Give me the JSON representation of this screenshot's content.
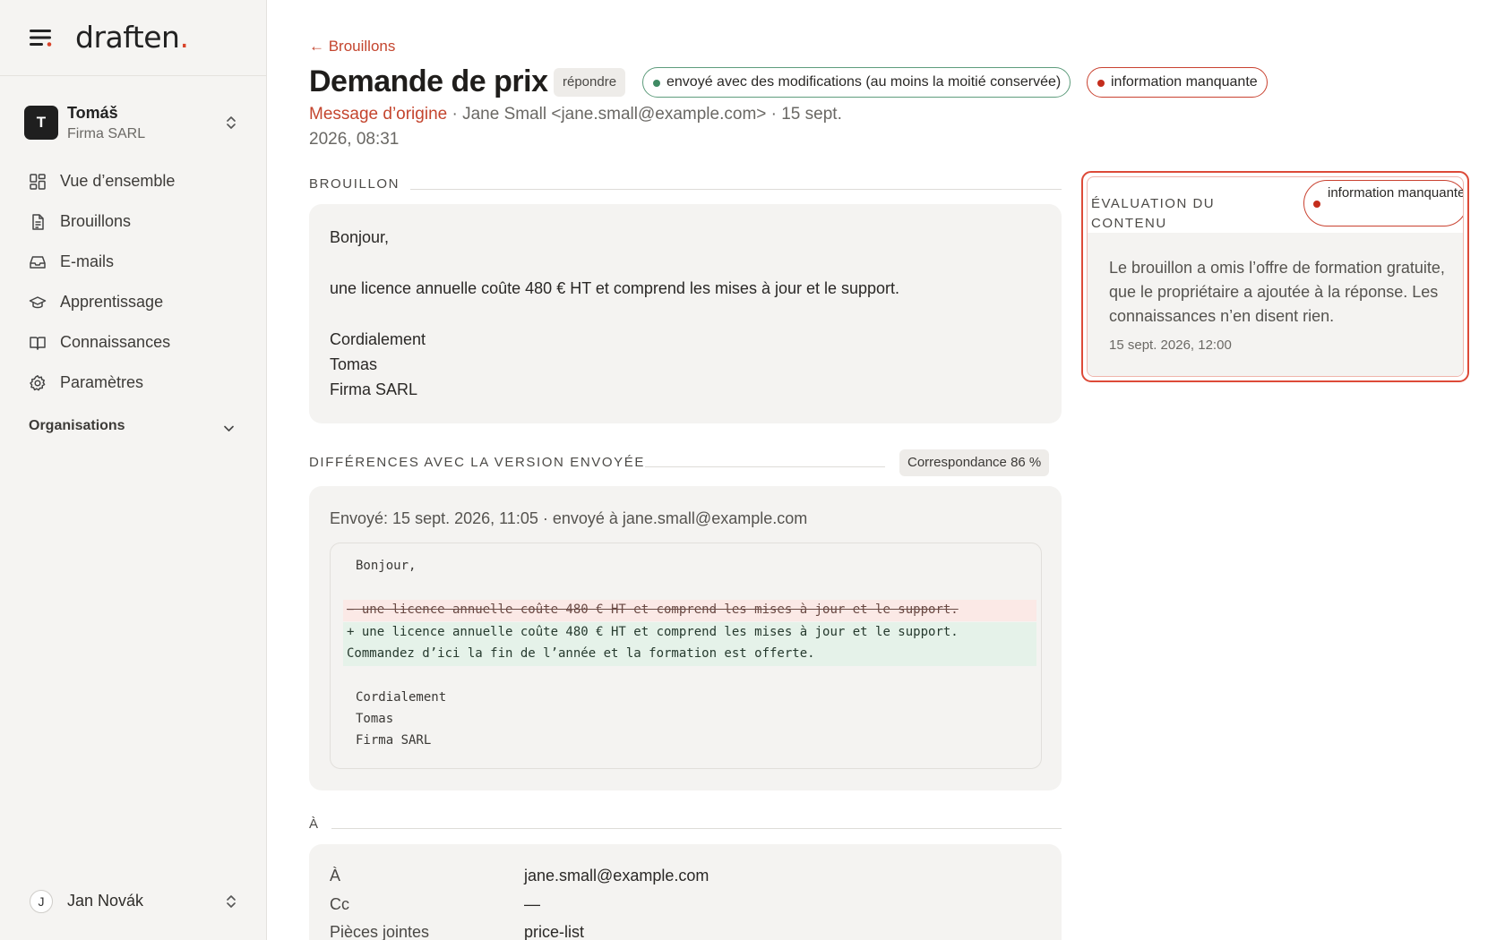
{
  "brand": {
    "name": "draften",
    "dot": "."
  },
  "org": {
    "initial": "T",
    "name": "Tomáš",
    "company": "Firma SARL"
  },
  "nav": [
    {
      "label": "Vue d’ensemble",
      "icon": "dashboard-icon"
    },
    {
      "label": "Brouillons",
      "icon": "document-icon"
    },
    {
      "label": "E-mails",
      "icon": "inbox-icon"
    },
    {
      "label": "Apprentissage",
      "icon": "graduation-cap-icon"
    },
    {
      "label": "Connaissances",
      "icon": "book-icon"
    },
    {
      "label": "Paramètres",
      "icon": "gear-icon"
    }
  ],
  "organisations_label": "Organisations",
  "user": {
    "initial": "J",
    "name": "Jan Novák"
  },
  "main": {
    "back_label": "← Brouillons",
    "title": "Demande de prix",
    "type_tag": "répondre",
    "status_pill": "envoyé avec des modifications (au moins la moitié conservée)",
    "issue_pill": "information manquante",
    "origin": {
      "link": "Message d’origine",
      "from": " · Jane Small <jane.small@example.com> · 15 sept. 2026, 08:31"
    }
  },
  "draft": {
    "heading": "BROUILLON",
    "lines": [
      "Bonjour,",
      "une licence annuelle coûte 480 € HT et comprend les mises à jour et le support.",
      "Cordialement",
      "Tomas",
      "Firma SARL"
    ]
  },
  "diff": {
    "heading": "DIFFÉRENCES AVEC LA VERSION ENVOYÉE",
    "match": "Correspondance 86 %",
    "sent": "Envoyé: 15 sept. 2026, 11:05 · envoyé à jane.small@example.com",
    "greeting": "Bonjour,",
    "removed": "− une licence annuelle coûte 480 € HT et comprend les mises à jour et le support.",
    "added_1": "+ une licence annuelle coûte 480 € HT et comprend les mises à jour et le support.",
    "added_2": "Commandez d’ici la fin de l’année et la formation est offerte.",
    "closing": [
      "Cordialement",
      "Tomas",
      "Firma SARL"
    ]
  },
  "recipients": {
    "heading": "À",
    "rows": [
      {
        "key": "À",
        "value": "jane.small@example.com"
      },
      {
        "key": "Cc",
        "value": "—"
      },
      {
        "key": "Pièces jointes",
        "value": "price-list"
      }
    ]
  },
  "evaluation": {
    "title": "ÉVALUATION DU CONTENU",
    "pill": "information manquante",
    "text": "Le brouillon a omis l’offre de formation gratuite, que le propriétaire a ajoutée à la réponse. Les connaissances n’en disent rien.",
    "timestamp": "15 sept. 2026, 12:00"
  },
  "colors": {
    "accent": "#c4452e",
    "added_bg": "#e5f2e9",
    "removed_bg": "#fbe9e6",
    "highlight_border": "#dd4a38"
  }
}
